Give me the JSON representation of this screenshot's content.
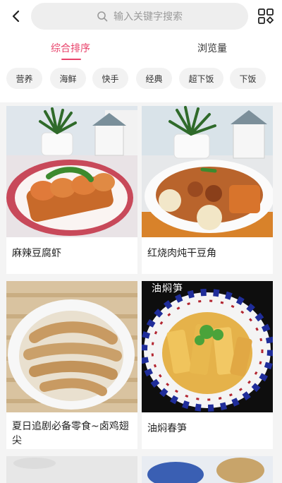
{
  "search": {
    "placeholder": "输入关键字搜索"
  },
  "tabs": [
    {
      "label": "综合排序",
      "active": true
    },
    {
      "label": "浏览量",
      "active": false
    }
  ],
  "chips": [
    "营养",
    "海鲜",
    "快手",
    "经典",
    "超下饭",
    "下饭"
  ],
  "cards": [
    {
      "title": "麻辣豆腐虾"
    },
    {
      "title": "红烧肉炖干豆角"
    },
    {
      "title_line1": "夏日追剧必备零食~卤鸡翅",
      "title_line2": "尖"
    },
    {
      "title": "油焖春笋",
      "overlay": "油焖笋"
    }
  ],
  "colors": {
    "accent": "#e8426a",
    "chip_bg": "#f2f2f2",
    "page_bg": "#f4f4f4"
  },
  "icons": [
    "back-arrow-icon",
    "search-icon",
    "scan-grid-icon"
  ]
}
